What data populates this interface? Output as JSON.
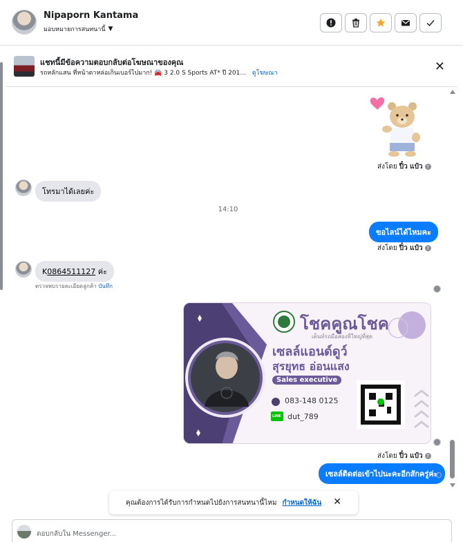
{
  "header": {
    "contact_name": "Nipaporn Kantama",
    "assign_label": "มอบหมายการสนทนานี้",
    "actions": [
      "report-icon",
      "trash-icon",
      "star-icon",
      "mail-icon",
      "check-icon"
    ],
    "accent_star": "#f5a623"
  },
  "ad_bar": {
    "title": "แชทนี้มีข้อความตอบกลับต่อโฆษณาของคุณ",
    "subtitle": "รถหลักแสน ที่หน้าตาหล่อเกินเบอร์ไปมาก! 🚘 3 2.0 S Sports AT* ปี 201...",
    "link": "ดูโฆษณา"
  },
  "messages": {
    "sticker_sent_prefix": "ส่งโดย",
    "sender_name": "ปิ๋ว แป๋ว",
    "msg1": "โทรมาได้เลยค่ะ",
    "time_sep": "14:10",
    "msg2": "ขอไลน์ได้ไหมคะ",
    "msg3_prefix": "K",
    "msg3_phone": "0864511127",
    "msg3_suffix": " ค่ะ",
    "note_text": "ตรวจพบรายละเอียดลูกค้า",
    "note_link": "บันทึก",
    "msg4": "เซลล์ติดต่อเข้าไปนะคะอีกสักครู่ค่ะ"
  },
  "card": {
    "brand": "โชคคูณโชค",
    "tagline": "เต็นท์รถมือสองที่ใหญ่ที่สุด",
    "title": "เซลล์แอนด์ดูว์",
    "name": "สุรยุทธ อ่อนแสง",
    "position": "Sales executive",
    "phone": "083-148 0125",
    "line_label": "LINE",
    "line_id": "dut_789"
  },
  "notify": {
    "text": "คุณต้องการได้รับการกำหนดไปยังการสนทนานี้ไหม",
    "link": "กำหนดให้ฉัน"
  },
  "composer": {
    "placeholder": "ตอบกลับใน Messenger..."
  },
  "colors": {
    "outgoing": "#0a7cff",
    "incoming": "#e4e6eb",
    "link": "#0064d1",
    "card_purple": "#6b5a9a"
  }
}
